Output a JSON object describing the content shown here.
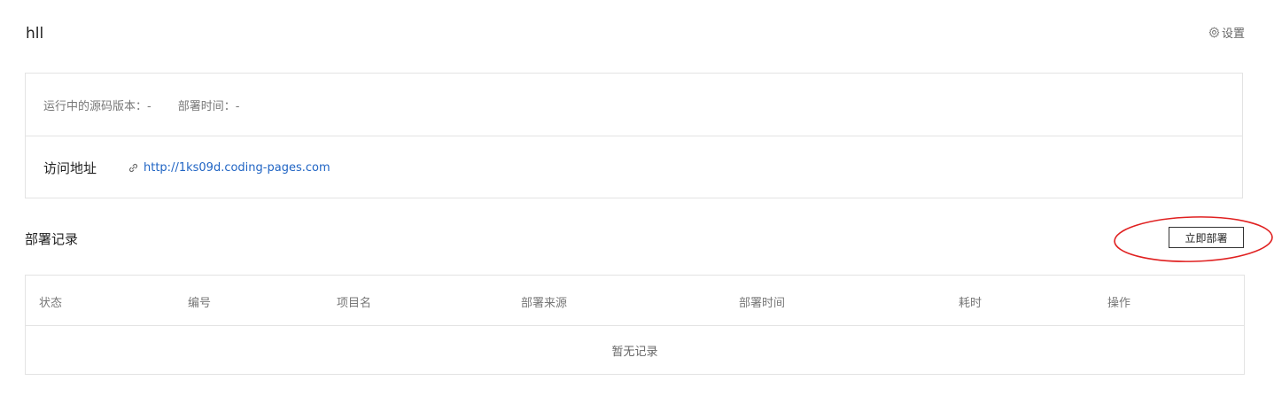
{
  "header": {
    "title": "hll",
    "settings_label": "设置",
    "settings_icon": "gear-icon"
  },
  "info": {
    "source_version_label": "运行中的源码版本：",
    "source_version_value": "-",
    "deploy_time_label": "部署时间：",
    "deploy_time_value": "-",
    "access_label": "访问地址",
    "access_icon": "link-icon",
    "access_url": "http://1ks09d.coding-pages.com"
  },
  "records": {
    "title": "部署记录",
    "deploy_button": "立即部署",
    "annotation_color": "#e02020",
    "columns": [
      "状态",
      "编号",
      "项目名",
      "部署来源",
      "部署时间",
      "耗时",
      "操作"
    ],
    "empty_text": "暂无记录"
  },
  "colors": {
    "link": "#2165c4",
    "border": "#e3e3e3",
    "muted_text": "#777777"
  }
}
